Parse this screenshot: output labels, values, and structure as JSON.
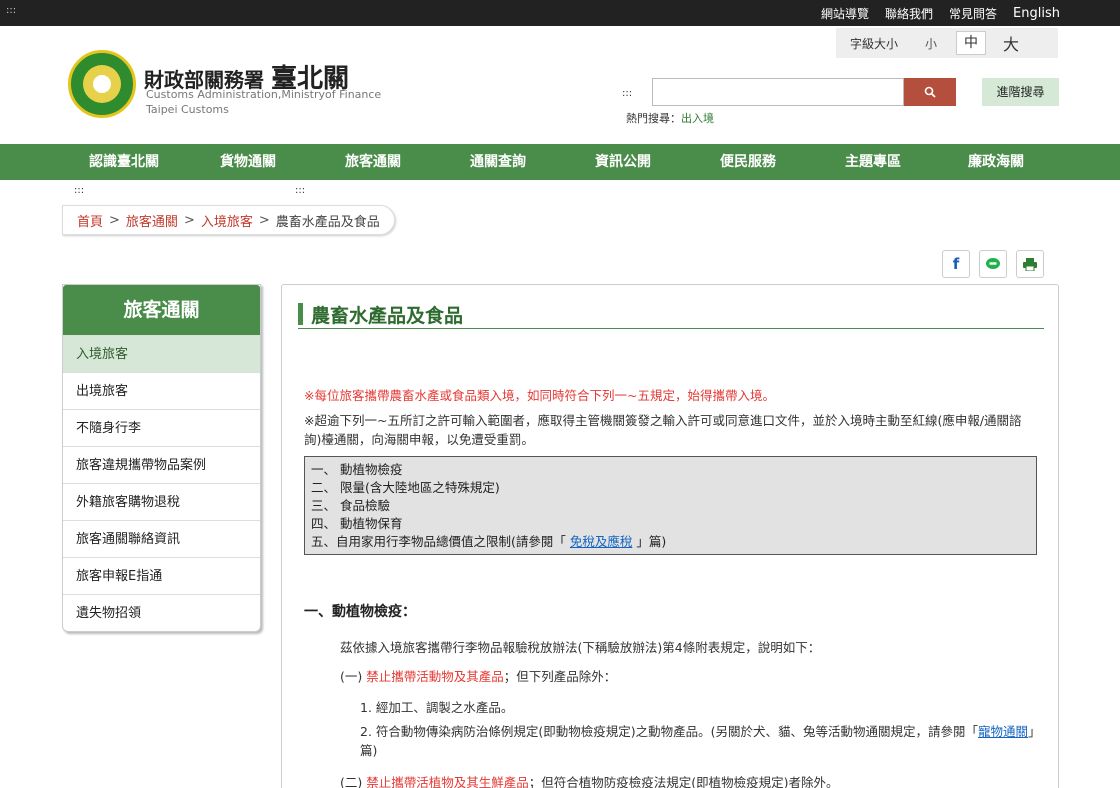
{
  "topbar": {
    "access_key": ":::",
    "links": [
      "網站導覽",
      "聯絡我們",
      "常見問答"
    ],
    "english": "English"
  },
  "font_size": {
    "label": "字級大小",
    "small": "小",
    "medium": "中",
    "large": "大"
  },
  "brand": {
    "name_prefix": "財政部關務署",
    "name_main": "臺北關",
    "en_line1": "Customs Administration,Ministryof Finance",
    "en_line2": "Taipei Customs"
  },
  "search": {
    "access_key": ":::",
    "value": "",
    "advanced_label": "進階搜尋",
    "hot_label": "熱門搜尋：",
    "hot_link": "出入境"
  },
  "nav": {
    "items": [
      "認識臺北關",
      "貨物通關",
      "旅客通關",
      "通關查詢",
      "資訊公開",
      "便民服務",
      "主題專區",
      "廉政海關"
    ],
    "access_key_left": ":::",
    "access_key_right": ":::"
  },
  "breadcrumb": {
    "home": "首頁",
    "level1": "旅客通關",
    "level2": "入境旅客",
    "current": "農畜水產品及食品",
    "sep": ">"
  },
  "share": {
    "facebook": "f"
  },
  "sidebar": {
    "title": "旅客通關",
    "items": [
      "入境旅客",
      "出境旅客",
      "不隨身行李",
      "旅客違規攜帶物品案例",
      "外籍旅客購物退稅",
      "旅客通關聯絡資訊",
      "旅客申報E指通",
      "遺失物招領"
    ]
  },
  "content": {
    "title": "農畜水產品及食品",
    "note1": "※每位旅客攜帶農畜水產或食品類入境，如同時符合下列一~五規定，始得攜帶入境。",
    "note2": "※超逾下列一~五所訂之許可輸入範圍者，應取得主管機關簽發之輸入許可或同意進口文件，並於入境時主動至紅線(應申報/通關諮詢)檯通關，向海關申報，以免遭受重罰。",
    "box_items": [
      "一、 動植物檢疫",
      "二、 限量(含大陸地區之特殊規定)",
      "三、 食品檢驗",
      "四、 動植物保育"
    ],
    "box_item5_pre": "五、自用家用行李物品總價值之限制(請參閱「 ",
    "box_item5_link": "免稅及應稅",
    "box_item5_post": " 」篇)",
    "section1_title": "一、動植物檢疫：",
    "section1_para": "茲依據入境旅客攜帶行李物品報驗稅放辦法(下稱驗放辦法)第4條附表規定，說明如下：",
    "p1_prefix": "(一) ",
    "p1_red": "禁止攜帶活動物及其產品",
    "p1_suffix": "；但下列產品除外：",
    "li1": "1. 經加工、調製之水產品。",
    "li2_pre": "2. 符合動物傳染病防治條例規定(即動物檢疫規定)之動物產品。(另關於犬、貓、兔等活動物通關規定，請參閱「",
    "li2_link": "寵物通關",
    "li2_post": "」篇)",
    "p2_prefix": "(二) ",
    "p2_red": "禁止攜帶活植物及其生鮮產品",
    "p2_suffix": "；但符合植物防疫檢疫法規定(即植物檢疫規定)者除外。"
  },
  "colors": {
    "green": "#4a8c4a",
    "red": "#e53935",
    "search_btn": "#b34f3c"
  }
}
